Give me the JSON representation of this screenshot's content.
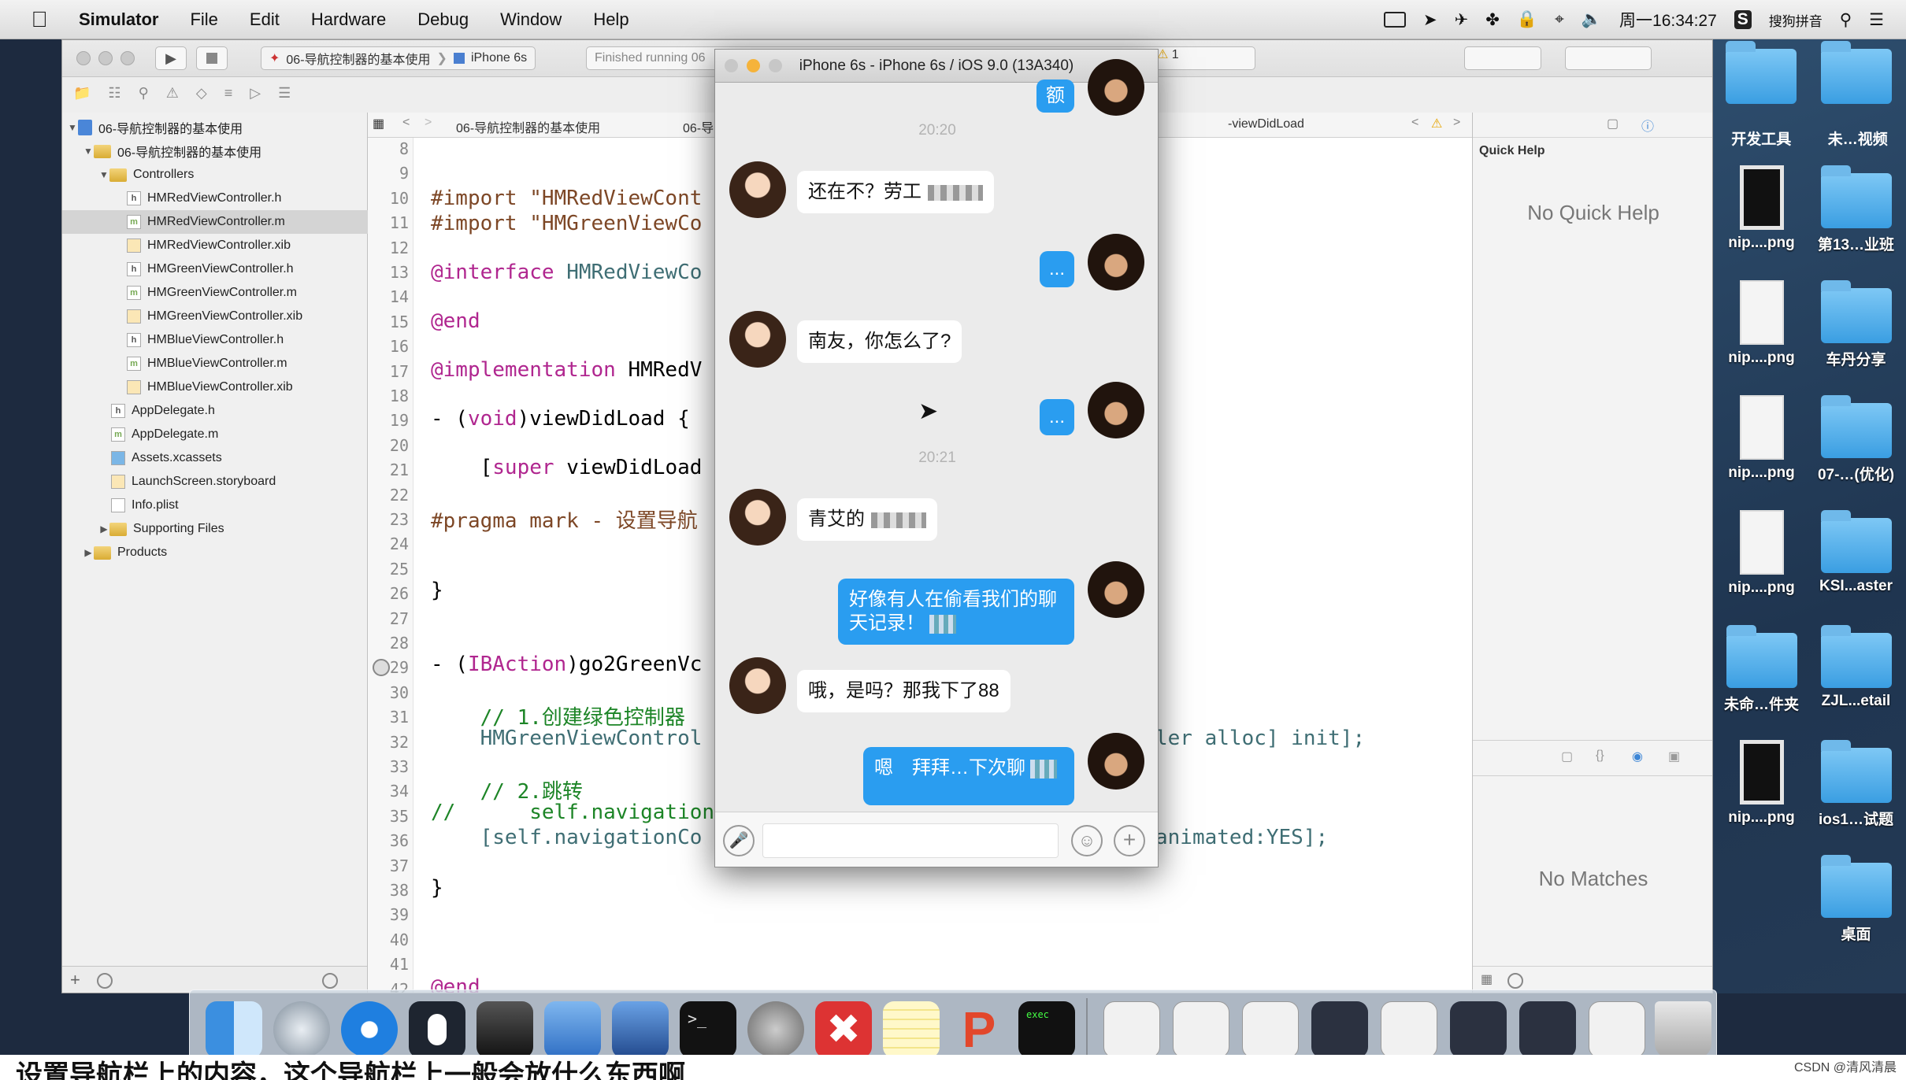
{
  "menubar": {
    "app": "Simulator",
    "items": [
      "File",
      "Edit",
      "Hardware",
      "Debug",
      "Window",
      "Help"
    ],
    "clock": "周一16:34:27",
    "input_method": "搜狗拼音"
  },
  "desktop": {
    "labels_top": [
      "开发工具",
      "未…视频"
    ],
    "items": [
      {
        "label": "nip....png",
        "kind": "file-dark"
      },
      {
        "label": "第13…业班",
        "kind": "folder"
      },
      {
        "label": "nip....png",
        "kind": "file"
      },
      {
        "label": "车丹分享",
        "kind": "folder"
      },
      {
        "label": "nip....png",
        "kind": "file"
      },
      {
        "label": "07-…(优化)",
        "kind": "folder"
      },
      {
        "label": "nip....png",
        "kind": "file"
      },
      {
        "label": "KSI...aster",
        "kind": "folder"
      },
      {
        "label": "未命…件夹",
        "kind": "folder"
      },
      {
        "label": "ZJL...etail",
        "kind": "folder"
      },
      {
        "label": "nip....png",
        "kind": "file-dark"
      },
      {
        "label": "ios1…试题",
        "kind": "folder"
      },
      {
        "label": "桌面",
        "kind": "folder"
      }
    ]
  },
  "xcode": {
    "scheme": "06-导航控制器的基本使用",
    "device": "iPhone 6s",
    "status": "Finished running 06",
    "warning_count": "1",
    "jumpbar": {
      "project": "06-导航控制器的基本使用",
      "folder": "06-导",
      "method": "-viewDidLoad"
    },
    "navigator": {
      "project": "06-导航控制器的基本使用",
      "group": "06-导航控制器的基本使用",
      "controllers": "Controllers",
      "files": [
        {
          "name": "HMRedViewController.h",
          "type": "h"
        },
        {
          "name": "HMRedViewController.m",
          "type": "m",
          "selected": true
        },
        {
          "name": "HMRedViewController.xib",
          "type": "xib"
        },
        {
          "name": "HMGreenViewController.h",
          "type": "h"
        },
        {
          "name": "HMGreenViewController.m",
          "type": "m"
        },
        {
          "name": "HMGreenViewController.xib",
          "type": "xib"
        },
        {
          "name": "HMBlueViewController.h",
          "type": "h"
        },
        {
          "name": "HMBlueViewController.m",
          "type": "m"
        },
        {
          "name": "HMBlueViewController.xib",
          "type": "xib"
        }
      ],
      "others": [
        {
          "name": "AppDelegate.h",
          "type": "h"
        },
        {
          "name": "AppDelegate.m",
          "type": "m"
        },
        {
          "name": "Assets.xcassets",
          "type": "assets"
        },
        {
          "name": "LaunchScreen.storyboard",
          "type": "sb"
        },
        {
          "name": "Info.plist",
          "type": "plist"
        }
      ],
      "supporting": "Supporting Files",
      "products": "Products"
    },
    "line_numbers": [
      "8",
      "9",
      "10",
      "11",
      "12",
      "13",
      "14",
      "15",
      "16",
      "17",
      "18",
      "19",
      "20",
      "21",
      "22",
      "23",
      "24",
      "25",
      "26",
      "27",
      "28",
      "29",
      "30",
      "31",
      "32",
      "33",
      "34",
      "35",
      "36",
      "37",
      "38",
      "39",
      "40",
      "41",
      "42"
    ],
    "code": {
      "l9": "#import \"HMRedViewCont",
      "l10": "#import \"HMGreenViewCo",
      "l12a": "@interface",
      "l12b": " HMRedViewCo",
      "l14": "@end",
      "l16a": "@implementation",
      "l16b": " HMRedV",
      "l18a": "- (",
      "l18b": "void",
      "l18c": ")viewDidLoad {",
      "l20a": "    [",
      "l20b": "super",
      "l20c": " viewDidLoad",
      "l22": "#pragma mark - 设置导航",
      "l25": "}",
      "l28a": "- (",
      "l28b": "IBAction",
      "l28c": ")go2GreenVc",
      "l30": "    // 1.创建绿色控制器",
      "l31": "    HMGreenViewControl",
      "l31r": "ler alloc] init];",
      "l33": "    // 2.跳转",
      "l34": "//      self.navigationC",
      "l35": "    [self.navigationCo",
      "l35r": "animated:YES];",
      "l37": "}",
      "l41": "@end"
    },
    "quick_help": {
      "title": "Quick Help",
      "text": "No Quick Help"
    },
    "library": {
      "text": "No Matches"
    }
  },
  "simulator": {
    "title": "iPhone 6s - iPhone 6s / iOS 9.0 (13A340)",
    "messages": [
      {
        "side": "right",
        "text": "额"
      },
      {
        "side": "time",
        "text": "20:20"
      },
      {
        "side": "left",
        "text": "还在不？劳工"
      },
      {
        "side": "right",
        "text": "..."
      },
      {
        "side": "left",
        "text": "南友，你怎么了?"
      },
      {
        "side": "right",
        "text": "..."
      },
      {
        "side": "time",
        "text": "20:21"
      },
      {
        "side": "left",
        "text": "青艾的"
      },
      {
        "side": "right",
        "text": "好像有人在偷看我们的聊天记录！"
      },
      {
        "side": "left",
        "text": "哦，是吗？那我下了88"
      },
      {
        "side": "right",
        "text": "嗯　拜拜…下次聊"
      }
    ]
  },
  "dock": [
    "Finder",
    "Launchpad",
    "Safari",
    "Mouse",
    "Photo Booth",
    "Xcode",
    "Instruments",
    "Terminal",
    "System Preferences",
    "XMind",
    "Notes",
    "PowerPoint",
    "exec"
  ],
  "bottom_caption": "设置导航栏上的内容，这个导航栏上一般会放什么东西啊",
  "watermark": "CSDN @清风清晨",
  "colors": {
    "bubble_blue": "#2a9df0",
    "keyword": "#b0268f",
    "comment": "#1d8527",
    "string": "#c41a16"
  }
}
